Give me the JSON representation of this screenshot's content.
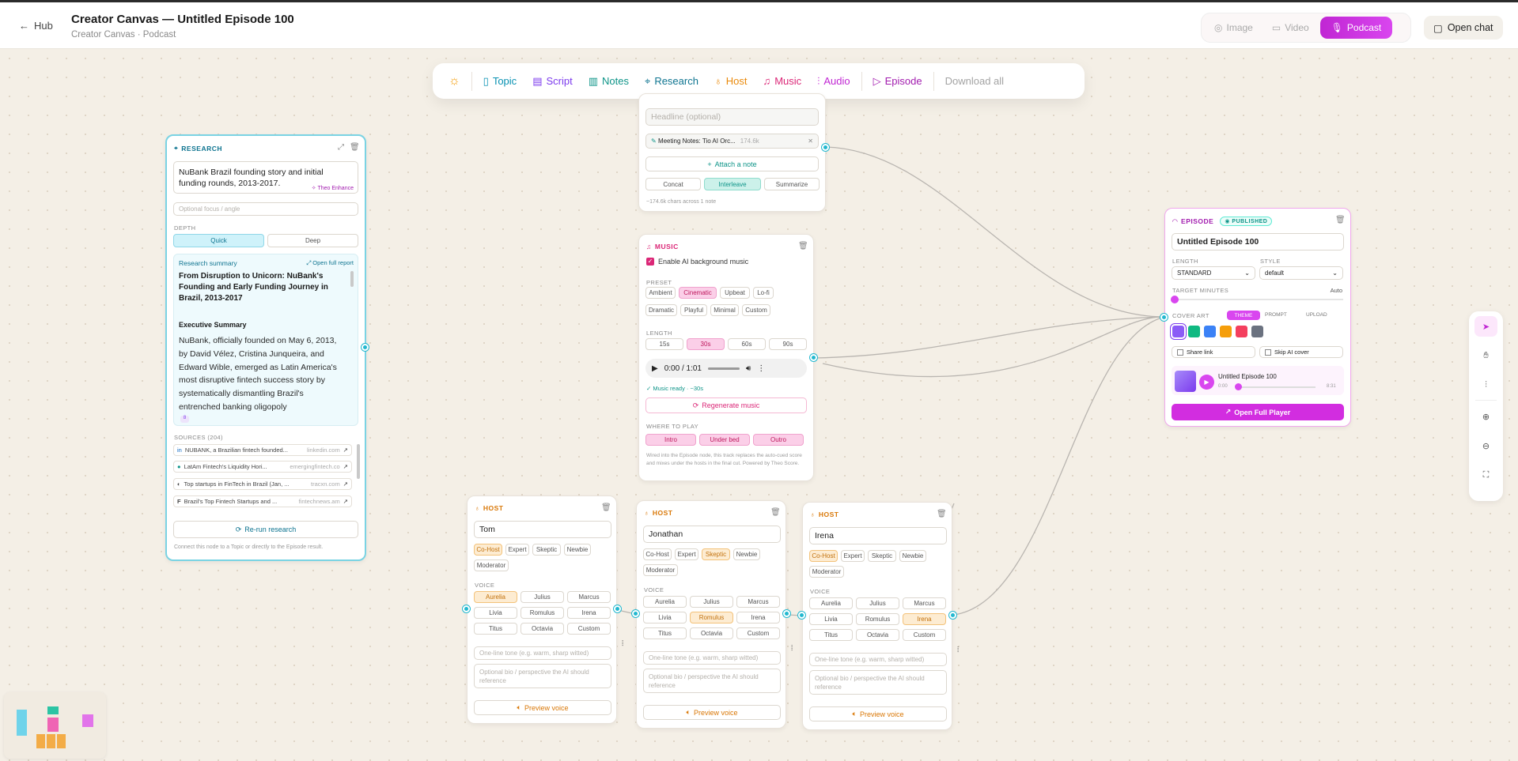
{
  "header": {
    "back_label": "Hub",
    "title": "Creator Canvas — Untitled Episode 100",
    "subtitle": "Creator Canvas · Podcast",
    "modes": [
      "Image",
      "Video",
      "Podcast"
    ],
    "open_chat": "Open chat"
  },
  "toolbar": {
    "items": [
      {
        "label": "Topic",
        "color": "#0891b2"
      },
      {
        "label": "Script",
        "color": "#7c3aed"
      },
      {
        "label": "Notes",
        "color": "#0d9488"
      },
      {
        "label": "Research",
        "color": "#0e7490"
      },
      {
        "label": "Host",
        "color": "#ea8a0c"
      },
      {
        "label": "Music",
        "color": "#db2777"
      },
      {
        "label": "Audio",
        "color": "#c026d3"
      },
      {
        "label": "Episode",
        "color": "#a21caf"
      }
    ],
    "download": "Download all"
  },
  "research": {
    "header": "RESEARCH",
    "topic": "NuBank Brazil founding story and initial funding rounds, 2013-2017.",
    "enhance": "Theo Enhance",
    "focus_placeholder": "Optional focus / angle",
    "depth_label": "DEPTH",
    "depth": [
      "Quick",
      "Deep"
    ],
    "summary_label": "Research summary",
    "open_full": "Open full report",
    "summary_title": "From Disruption to Unicorn: NuBank's Founding and Early Funding Journey in Brazil, 2013-2017",
    "exec_label": "Executive Summary",
    "exec_text": "NuBank, officially founded on May 6, 2013, by David Vélez, Cristina Junqueira, and Edward Wible, emerged as Latin America's most disruptive fintech success story by systematically dismantling Brazil's entrenched banking oligopoly",
    "ref": "8",
    "sources_label": "SOURCES (204)",
    "sources": [
      {
        "title": "NUBANK, a Brazilian fintech founded...",
        "domain": "linkedin.com"
      },
      {
        "title": "LatAm Fintech's Liquidity Hori...",
        "domain": "emergingfintech.co"
      },
      {
        "title": "Top startups in FinTech in Brazil (Jan, ...",
        "domain": "tracxn.com"
      },
      {
        "title": "Brazil's Top Fintech Startups and ...",
        "domain": "fintechnews.am"
      }
    ],
    "rerun": "Re-run research",
    "footer": "Connect this node to a Topic or directly to the Episode result."
  },
  "notes": {
    "headline_placeholder": "Headline (optional)",
    "note_title": "Meeting Notes: Tio AI Orc...",
    "note_size": "174.6k",
    "attach": "Attach a note",
    "modes": [
      "Concat",
      "Interleave",
      "Summarize"
    ],
    "footer": "~174.6k chars across 1 note"
  },
  "music": {
    "header": "MUSIC",
    "enable": "Enable AI background music",
    "preset_label": "PRESET",
    "presets": [
      "Ambient",
      "Cinematic",
      "Upbeat",
      "Lo-fi",
      "Dramatic",
      "Playful",
      "Minimal",
      "Custom"
    ],
    "length_label": "LENGTH",
    "lengths": [
      "15s",
      "30s",
      "60s",
      "90s"
    ],
    "time": "0:00 / 1:01",
    "ready": "Music ready · ~30s",
    "regen": "Regenerate music",
    "where_label": "WHERE TO PLAY",
    "where": [
      "Intro",
      "Under bed",
      "Outro"
    ],
    "desc": "Wired into the Episode node, this track replaces the auto-cued score and mixes under the hosts in the final cut. Powered by Theo Score."
  },
  "hosts": [
    {
      "header": "HOST",
      "name": "Tom",
      "role": "Co-Host",
      "voice": "Aurelia"
    },
    {
      "header": "HOST",
      "name": "Jonathan",
      "role": "Skeptic",
      "voice": "Romulus"
    },
    {
      "header": "HOST",
      "name": "Irena",
      "role": "Co-Host",
      "voice": "Irena"
    }
  ],
  "host_common": {
    "roles": [
      "Co-Host",
      "Expert",
      "Skeptic",
      "Newbie",
      "Moderator"
    ],
    "voice_label": "VOICE",
    "voices": [
      "Aurelia",
      "Julius",
      "Marcus",
      "Livia",
      "Romulus",
      "Irena",
      "Titus",
      "Octavia",
      "Custom"
    ],
    "tone_placeholder": "One-line tone (e.g. warm, sharp witted)",
    "bio_placeholder": "Optional bio / perspective the AI should reference",
    "preview": "Preview voice"
  },
  "episode": {
    "header": "EPISODE",
    "badge": "PUBLISHED",
    "title": "Untitled Episode 100",
    "length_label": "LENGTH",
    "length": "STANDARD",
    "style_label": "STYLE",
    "style": "default",
    "target_label": "TARGET MINUTES",
    "target_value": "Auto",
    "cover_label": "COVER ART",
    "cover_tabs": [
      "THEME",
      "PROMPT",
      "UPLOAD"
    ],
    "swatches": [
      "#8b5cf6",
      "#10b981",
      "#3b82f6",
      "#f59e0b",
      "#f43f5e",
      "#6b7280"
    ],
    "share": "Share link",
    "skip": "Skip AI cover",
    "player_title": "Untitled Episode 100",
    "player_start": "0:00",
    "player_end": "8:31",
    "open_player": "Open Full Player"
  },
  "colors": {
    "research": "#22b8cf",
    "music": "#ec4899",
    "host": "#f59e0b",
    "episode": "#d946ef",
    "podcast": "#c026d3"
  }
}
